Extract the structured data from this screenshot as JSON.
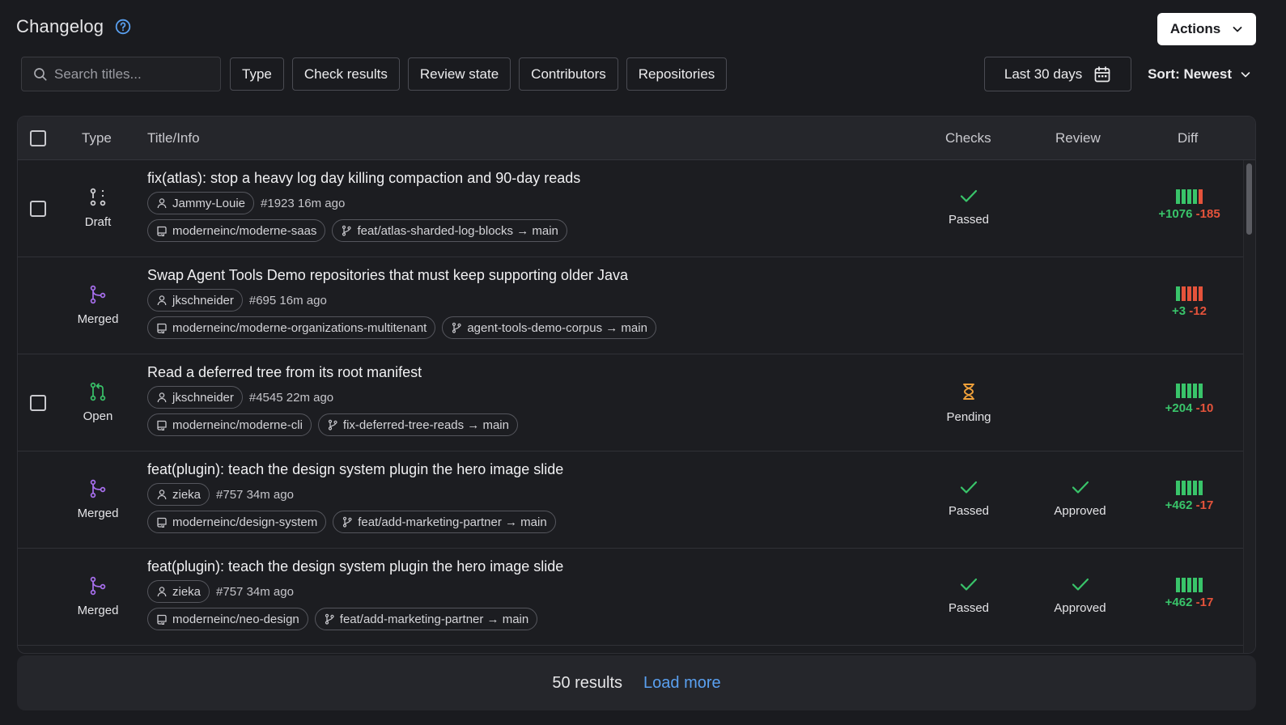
{
  "header": {
    "title": "Changelog",
    "help_icon": "help-circle-icon",
    "actions_label": "Actions"
  },
  "toolbar": {
    "search_placeholder": "Search titles...",
    "filters": [
      "Type",
      "Check results",
      "Review state",
      "Contributors",
      "Repositories"
    ],
    "date_range": "Last 30 days",
    "sort": "Sort: Newest"
  },
  "table": {
    "columns": {
      "type": "Type",
      "title": "Title/Info",
      "checks": "Checks",
      "review": "Review",
      "diff": "Diff"
    },
    "rows": [
      {
        "type": "Draft",
        "type_icon": "draft-pr-icon",
        "type_color": "#d6d6da",
        "has_checkbox": true,
        "title": "fix(atlas): stop a heavy log day killing compaction and 90-day reads",
        "author": "Jammy-Louie",
        "meta": "#1923 16m ago",
        "repo": "moderneinc/moderne-saas",
        "branch": "feat/atlas-sharded-log-blocks → main",
        "checks": "Passed",
        "checks_icon": "check-icon",
        "review": "",
        "review_icon": "",
        "additions": "+1076",
        "deletions": "-185",
        "diff_bars": [
          "add",
          "add",
          "add",
          "add",
          "del"
        ]
      },
      {
        "type": "Merged",
        "type_icon": "merge-icon",
        "type_color": "#a970f0",
        "has_checkbox": false,
        "title": "Swap Agent Tools Demo repositories that must keep supporting older Java",
        "author": "jkschneider",
        "meta": "#695 16m ago",
        "repo": "moderneinc/moderne-organizations-multitenant",
        "branch": "agent-tools-demo-corpus → main",
        "checks": "",
        "checks_icon": "",
        "review": "",
        "review_icon": "",
        "additions": "+3",
        "deletions": "-12",
        "diff_bars": [
          "add",
          "del",
          "del",
          "del",
          "del"
        ]
      },
      {
        "type": "Open",
        "type_icon": "open-pr-icon",
        "type_color": "#39c46a",
        "has_checkbox": true,
        "title": "Read a deferred tree from its root manifest",
        "author": "jkschneider",
        "meta": "#4545 22m ago",
        "repo": "moderneinc/moderne-cli",
        "branch": "fix-deferred-tree-reads → main",
        "checks": "Pending",
        "checks_icon": "hourglass-icon",
        "review": "",
        "review_icon": "",
        "additions": "+204",
        "deletions": "-10",
        "diff_bars": [
          "add",
          "add",
          "add",
          "add",
          "add"
        ]
      },
      {
        "type": "Merged",
        "type_icon": "merge-icon",
        "type_color": "#a970f0",
        "has_checkbox": false,
        "title": "feat(plugin): teach the design system plugin the hero image slide",
        "author": "zieka",
        "meta": "#757 34m ago",
        "repo": "moderneinc/design-system",
        "branch": "feat/add-marketing-partner → main",
        "checks": "Passed",
        "checks_icon": "check-icon",
        "review": "Approved",
        "review_icon": "check-icon",
        "additions": "+462",
        "deletions": "-17",
        "diff_bars": [
          "add",
          "add",
          "add",
          "add",
          "add"
        ]
      },
      {
        "type": "Merged",
        "type_icon": "merge-icon",
        "type_color": "#a970f0",
        "has_checkbox": false,
        "title": "feat(plugin): teach the design system plugin the hero image slide",
        "author": "zieka",
        "meta": "#757 34m ago",
        "repo": "moderneinc/neo-design",
        "branch": "feat/add-marketing-partner → main",
        "checks": "Passed",
        "checks_icon": "check-icon",
        "review": "Approved",
        "review_icon": "check-icon",
        "additions": "+462",
        "deletions": "-17",
        "diff_bars": [
          "add",
          "add",
          "add",
          "add",
          "add"
        ]
      }
    ]
  },
  "footer": {
    "result_count": "50 results",
    "load_more": "Load more"
  },
  "colors": {
    "add": "#39c46a",
    "del": "#e5533b",
    "pending": "#f0a13a",
    "link": "#5aa0f0"
  }
}
